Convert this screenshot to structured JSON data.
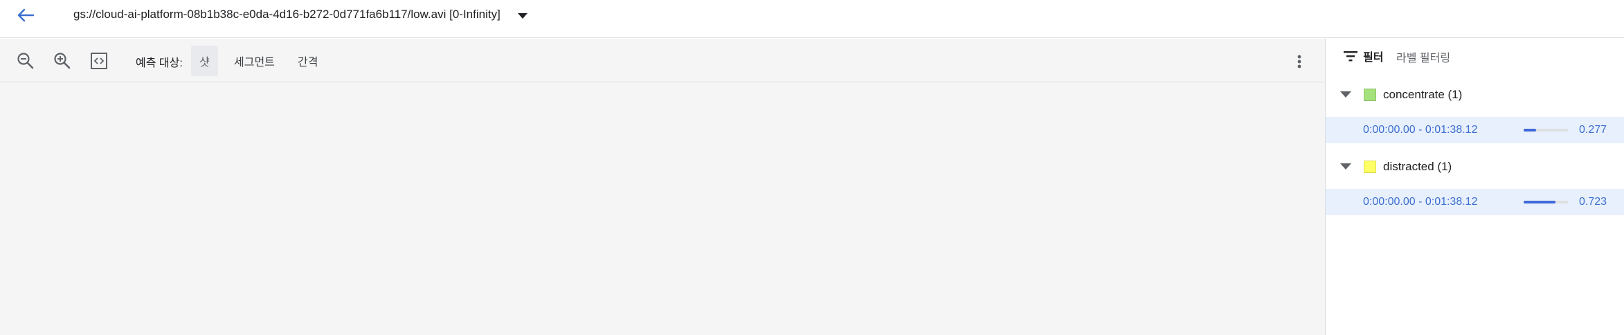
{
  "header": {
    "file_title": "gs://cloud-ai-platform-08b1b38c-e0da-4d16-b272-0d771fa6b117/low.avi [0-Infinity]"
  },
  "toolbar": {
    "predict_label": "예측 대상:",
    "tabs": [
      {
        "label": "샷",
        "active": true
      },
      {
        "label": "세그먼트",
        "active": false
      },
      {
        "label": "간격",
        "active": false
      }
    ]
  },
  "filter_panel": {
    "filter_label": "필터",
    "label_filter": "라벨 필터링",
    "groups": [
      {
        "name": "concentrate (1)",
        "color": "#a5e27b",
        "results": [
          {
            "time_range": "0:00:00.00 - 0:01:38.12",
            "score": 0.277,
            "score_text": "0.277"
          }
        ]
      },
      {
        "name": "distracted (1)",
        "color": "#ffff66",
        "results": [
          {
            "time_range": "0:00:00.00 - 0:01:38.12",
            "score": 0.723,
            "score_text": "0.723"
          }
        ]
      }
    ]
  },
  "colors": {
    "accent": "#3f68d8",
    "selected_row": "#e8f0fe"
  }
}
